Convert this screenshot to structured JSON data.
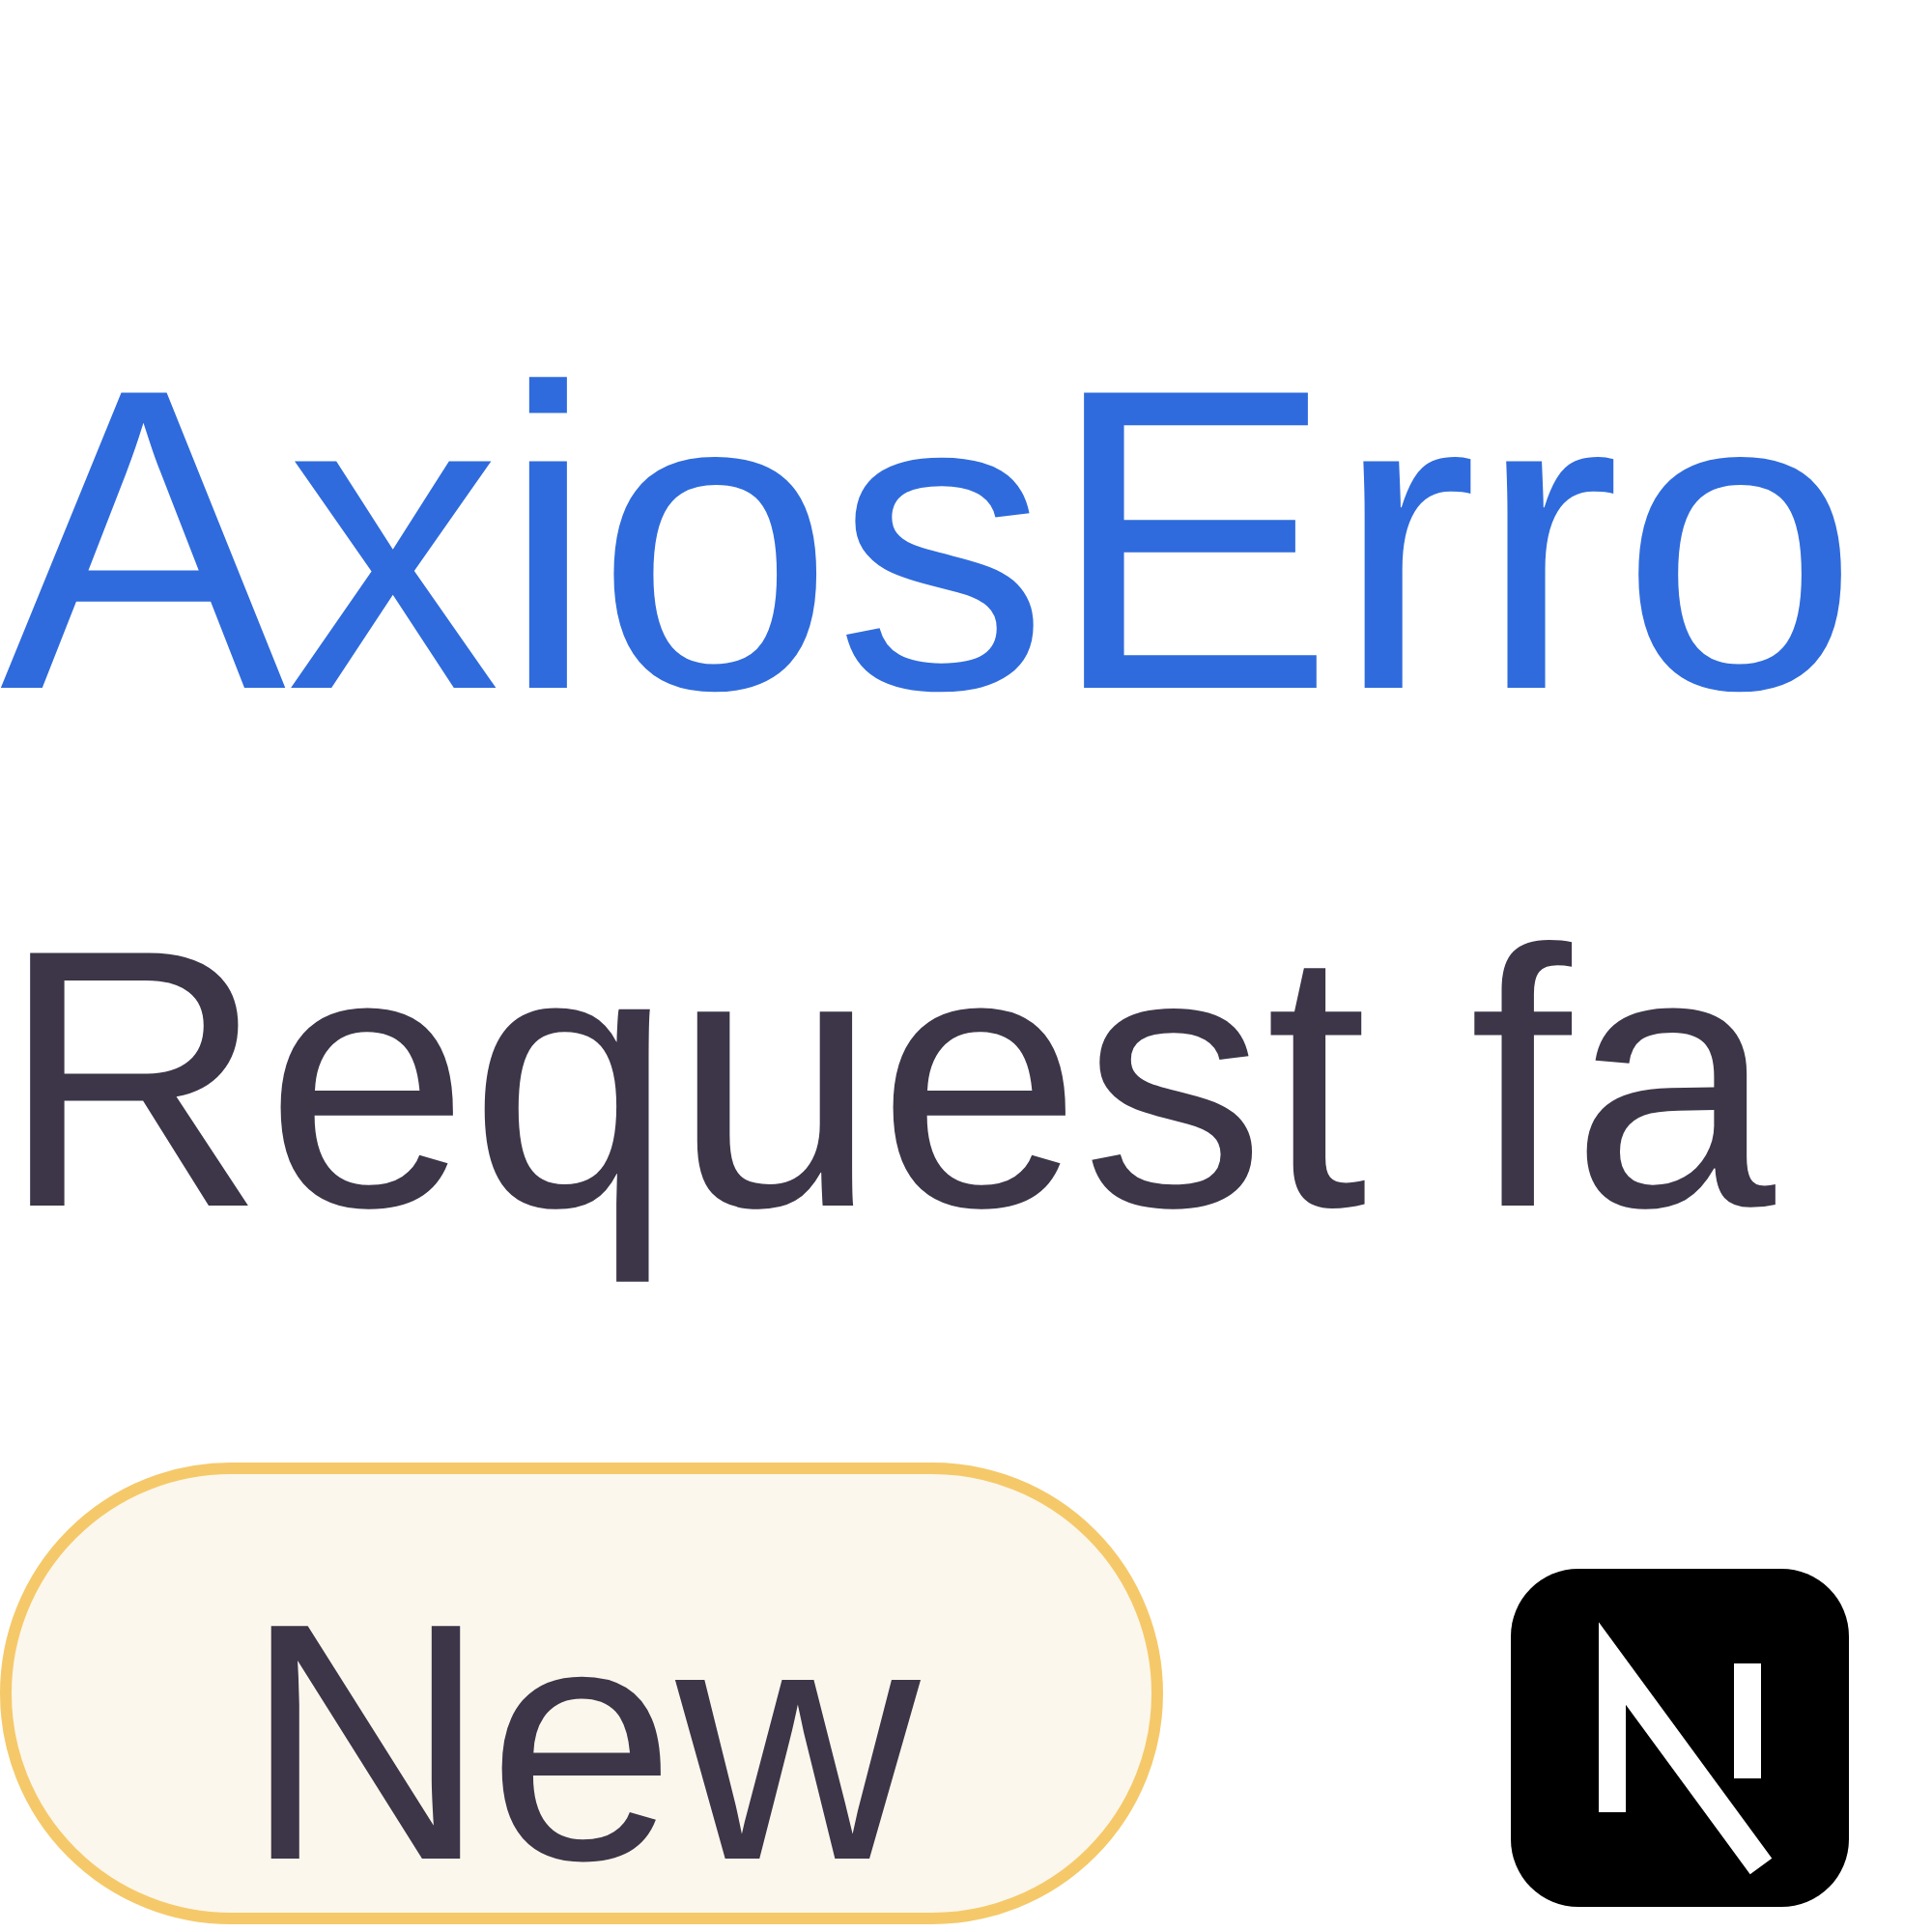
{
  "error": {
    "title": "AxiosErro",
    "message": "Request fa",
    "status": {
      "label": "New"
    }
  }
}
